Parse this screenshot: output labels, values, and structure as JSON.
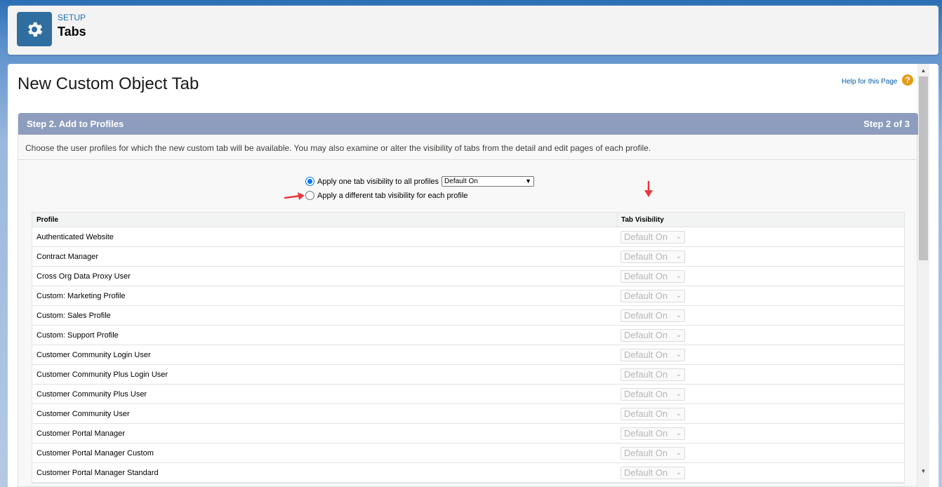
{
  "header": {
    "eyebrow": "SETUP",
    "title": "Tabs",
    "icon": "gear-icon"
  },
  "page": {
    "title": "New Custom Object Tab",
    "help_link": "Help for this Page"
  },
  "step": {
    "label": "Step 2. Add to Profiles",
    "count": "Step 2 of 3",
    "description": "Choose the user profiles for which the new custom tab will be available. You may also examine or alter the visibility of tabs from the detail and edit pages of each profile."
  },
  "options": {
    "apply_all_label": "Apply one tab visibility to all profiles",
    "apply_all_value": "Default On",
    "apply_each_label": "Apply a different tab visibility for each profile"
  },
  "table": {
    "col_profile": "Profile",
    "col_visibility": "Tab Visibility",
    "rows": [
      {
        "profile": "Authenticated Website",
        "visibility": "Default On"
      },
      {
        "profile": "Contract Manager",
        "visibility": "Default On"
      },
      {
        "profile": "Cross Org Data Proxy User",
        "visibility": "Default On"
      },
      {
        "profile": "Custom: Marketing Profile",
        "visibility": "Default On"
      },
      {
        "profile": "Custom: Sales Profile",
        "visibility": "Default On"
      },
      {
        "profile": "Custom: Support Profile",
        "visibility": "Default On"
      },
      {
        "profile": "Customer Community Login User",
        "visibility": "Default On"
      },
      {
        "profile": "Customer Community Plus Login User",
        "visibility": "Default On"
      },
      {
        "profile": "Customer Community Plus User",
        "visibility": "Default On"
      },
      {
        "profile": "Customer Community User",
        "visibility": "Default On"
      },
      {
        "profile": "Customer Portal Manager",
        "visibility": "Default On"
      },
      {
        "profile": "Customer Portal Manager Custom",
        "visibility": "Default On"
      },
      {
        "profile": "Customer Portal Manager Standard",
        "visibility": "Default On"
      }
    ]
  },
  "colors": {
    "accent": "#0075ff",
    "step_header": "#8e9dbe",
    "annotation_arrow": "#e8393f"
  }
}
